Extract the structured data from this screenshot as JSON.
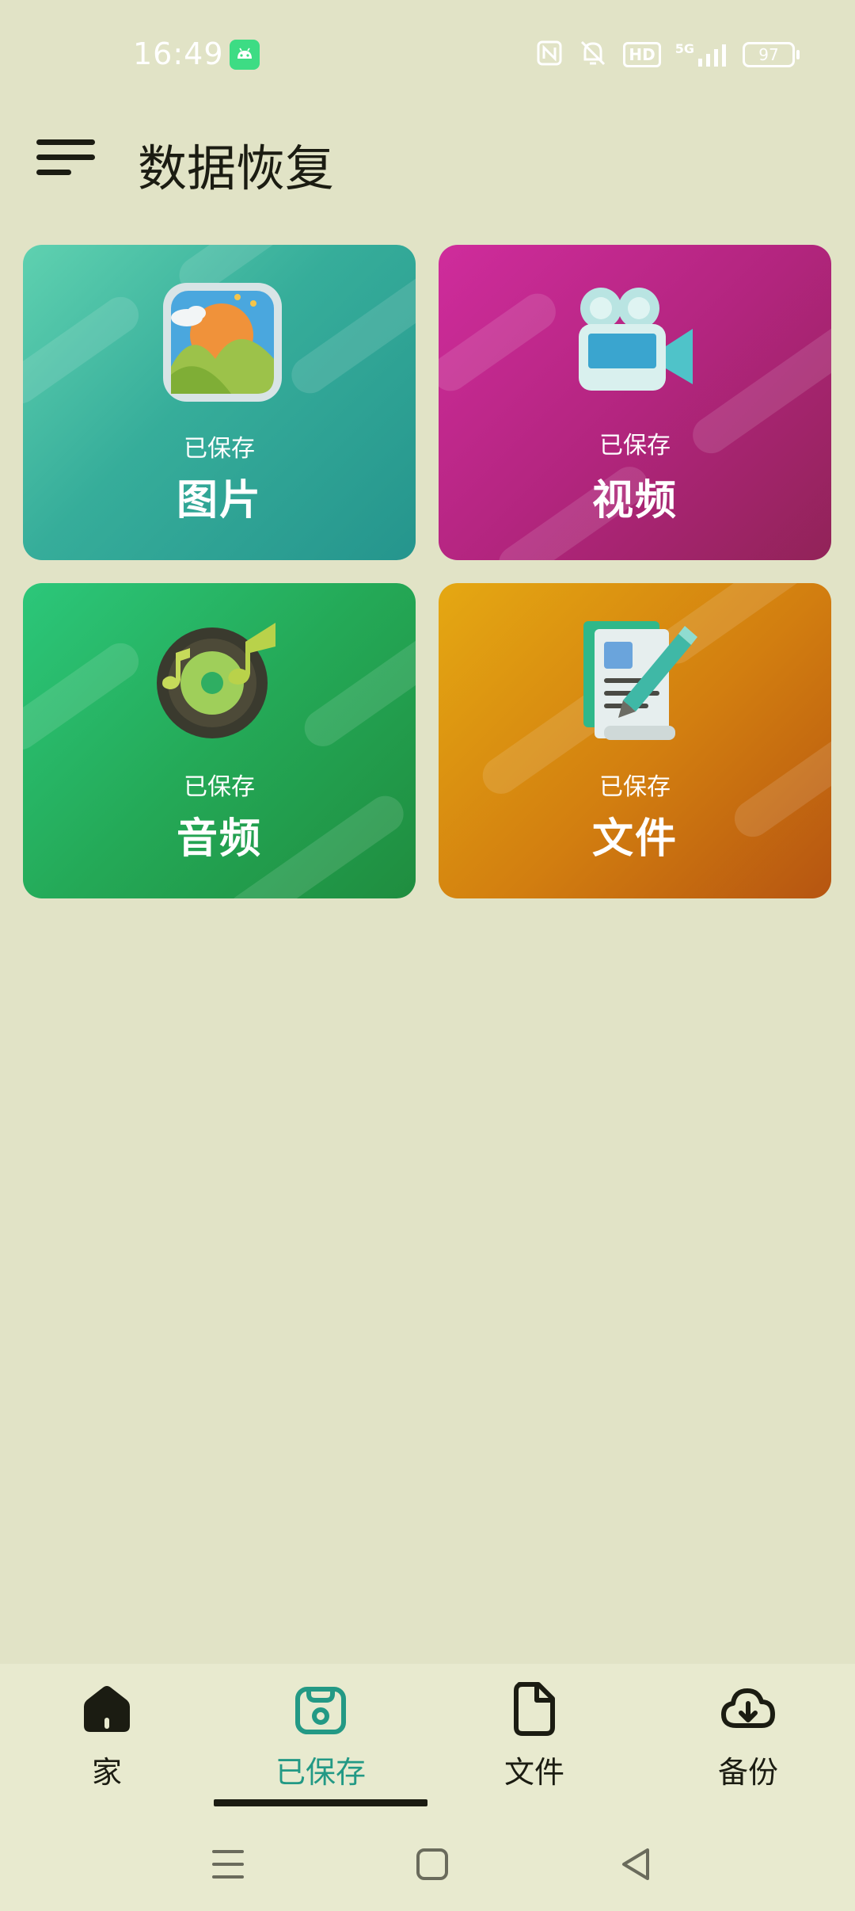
{
  "status_bar": {
    "time": "16:49",
    "hd_label": "HD",
    "network_label": "5G",
    "battery": "97"
  },
  "header": {
    "title": "数据恢复"
  },
  "cards": [
    {
      "id": "pictures",
      "subtitle": "已保存",
      "title": "图片",
      "icon": "picture-gallery-icon",
      "color": "#36ad9a"
    },
    {
      "id": "videos",
      "subtitle": "已保存",
      "title": "视频",
      "icon": "video-camera-icon",
      "color": "#b3257f"
    },
    {
      "id": "audio",
      "subtitle": "已保存",
      "title": "音频",
      "icon": "music-disc-icon",
      "color": "#24a957"
    },
    {
      "id": "files",
      "subtitle": "已保存",
      "title": "文件",
      "icon": "document-edit-icon",
      "color": "#d27e10"
    }
  ],
  "bottom_nav": {
    "items": [
      {
        "label": "家",
        "icon": "home-icon"
      },
      {
        "label": "已保存",
        "icon": "saved-bag-icon"
      },
      {
        "label": "文件",
        "icon": "file-icon"
      },
      {
        "label": "备份",
        "icon": "cloud-download-icon"
      }
    ],
    "active_index": 1,
    "active_color": "#239985"
  },
  "system_nav": {
    "items": [
      "recent-apps-icon",
      "home-button-icon",
      "back-icon"
    ]
  }
}
